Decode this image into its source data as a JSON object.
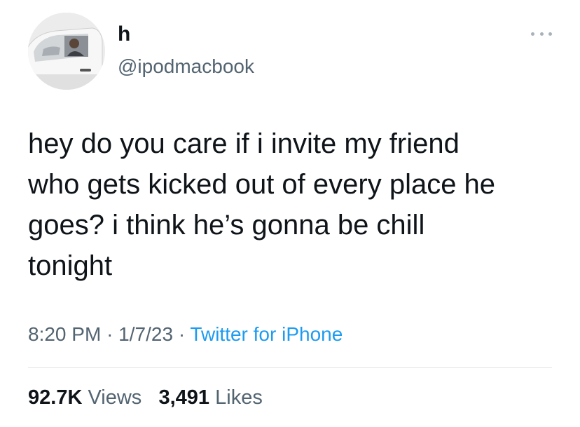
{
  "author": {
    "display_name": "h",
    "handle": "@ipodmacbook"
  },
  "tweet": {
    "text": "hey do you care if i invite my friend\nwho gets kicked out of every place he\ngoes? i think he’s gonna be chill\ntonight"
  },
  "meta": {
    "time": "8:20 PM",
    "sep1": "·",
    "date": "1/7/23",
    "sep2": "·",
    "source": "Twitter for iPhone"
  },
  "stats": {
    "views_count": "92.7K",
    "views_label": "Views",
    "likes_count": "3,491",
    "likes_label": "Likes"
  },
  "icons": {
    "more": "more-icon"
  },
  "colors": {
    "text": "#0f1419",
    "secondary": "#536471",
    "link": "#1d9bf0"
  }
}
